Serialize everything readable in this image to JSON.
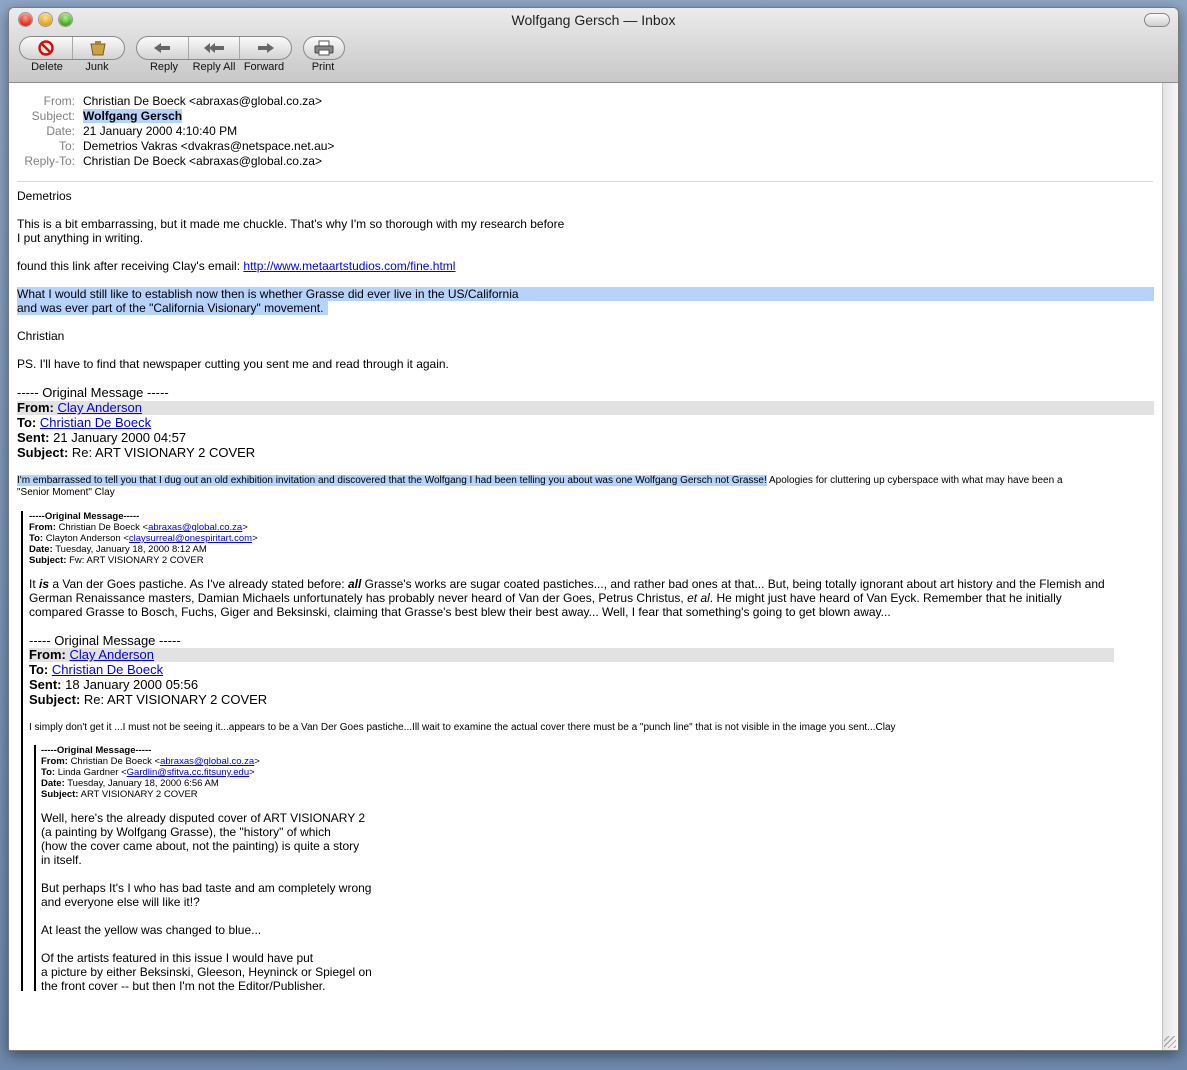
{
  "window": {
    "title": "Wolfgang Gersch — Inbox"
  },
  "toolbar": {
    "delete": "Delete",
    "junk": "Junk",
    "reply": "Reply",
    "reply_all": "Reply All",
    "forward": "Forward",
    "print": "Print"
  },
  "headers": {
    "from_label": "From:",
    "from": "Christian De Boeck <abraxas@global.co.za>",
    "subject_label": "Subject:",
    "subject": "Wolfgang Gersch",
    "date_label": "Date:",
    "date": "21 January 2000 4:10:40 PM",
    "to_label": "To:",
    "to": "Demetrios Vakras <dvakras@netspace.net.au>",
    "reply_to_label": "Reply-To:",
    "reply_to": "Christian De Boeck <abraxas@global.co.za>"
  },
  "body": {
    "greeting": "Demetrios",
    "p1_l1": "This is a bit embarrassing, but it made me chuckle. That's why I'm so thorough with my research before",
    "p1_l2": "I put anything in writing.",
    "p2_pre": "found this link after receiving Clay's email: ",
    "p2_link": "http://www.metaartstudios.com/fine.html",
    "p3_pre": "What ",
    "p3_hl1": "I would still like to establish now then is whether Grasse did ever live in the US/California",
    "p3_hl2": "and was ever part of the \"California Visionary\" movement.",
    "sign": "Christian",
    "ps": "PS. I'll have to find that newspaper cutting you sent me and read through it again."
  },
  "quote1": {
    "header": "----- Original Message -----",
    "from_label": "From:",
    "from": "Clay Anderson",
    "to_label": "To:",
    "to": "Christian De Boeck",
    "sent_label": "Sent:",
    "sent": "21 January 2000 04:57",
    "subject_label": "Subject:",
    "subject": "Re: ART VISIONARY 2 COVER",
    "msg_hl": "I'm embarrassed to tell you that I dug out an old exhibition invitation and discovered that the Wolfgang I had been telling you about was one Wolfgang Gersch not Grasse!",
    "msg_rest": " Apologies for cluttering up cyberspace with what may have been a",
    "msg_l2": "\"Senior Moment\"   Clay"
  },
  "quote2": {
    "header": "-----Original Message-----",
    "from_label": "From:",
    "from_pre": "Christian De Boeck <",
    "from_email": "abraxas@global.co.za",
    "from_post": ">",
    "to_label": "To:",
    "to_pre": "Clayton Anderson <",
    "to_email": "claysurreal@onespiritart.com",
    "to_post": ">",
    "date_label": "Date:",
    "date": "Tuesday, January 18, 2000 8:12 AM",
    "subject_label": "Subject:",
    "subject": "Fw: ART VISIONARY 2 COVER",
    "l1_a": "It ",
    "l1_is": "is",
    "l1_b": " a Van der Goes pastiche. As I've already stated before: ",
    "l1_all": "all",
    "l1_c": " Grasse's works are sugar coated pastiches..., and rather bad ones at that... But, being totally ignorant about art history and the Flemish and",
    "l2_a": "German Renaissance masters, Damian Michaels unfortunately has probably never heard of Van der Goes, Petrus Christus, ",
    "l2_etal": "et al",
    "l2_b": ". He might just have heard of Van Eyck. Remember that he initially",
    "l3": "compared Grasse to Bosch, Fuchs, Giger and Beksinski, claiming that Grasse's best blew their best away... Well, I fear that something's going to get blown away..."
  },
  "quote3": {
    "header": "----- Original Message -----",
    "from_label": "From:",
    "from": "Clay Anderson",
    "to_label": "To:",
    "to": "Christian De Boeck",
    "sent_label": "Sent:",
    "sent": "18 January 2000 05:56",
    "subject_label": "Subject:",
    "subject": "Re: ART VISIONARY 2 COVER",
    "msg": "I simply don't get it ...I must not be seeing it...appears to be a Van Der Goes pastiche...Ill wait to examine the actual cover there must be a \"punch line\" that is not visible in the image you sent...Clay"
  },
  "quote4": {
    "header": "-----Original Message-----",
    "from_label": "From:",
    "from_pre": "Christian De Boeck <",
    "from_email": "abraxas@global.co.za",
    "from_post": ">",
    "to_label": "To:",
    "to_pre": "Linda Gardner <",
    "to_email": "Gardlin@sfitva.cc.fitsuny.edu",
    "to_post": ">",
    "date_label": "Date:",
    "date": "Tuesday, January 18, 2000 6:56 AM",
    "subject_label": "Subject:",
    "subject": "ART VISIONARY 2 COVER",
    "b1": "Well, here's the already disputed cover of ART VISIONARY 2",
    "b2": "(a painting by Wolfgang Grasse), the \"history\" of which",
    "b3": "(how the cover came about, not the painting) is quite a story",
    "b4": "in itself.",
    "b5": "But perhaps It's I who has bad taste and am completely wrong",
    "b6": "and everyone else will like it!?",
    "b7": "At least the yellow was changed to blue...",
    "b8": "Of the artists featured in this issue I would have put",
    "b9": "a picture by either Beksinski, Gleeson, Heyninck or Spiegel on",
    "b10": "the front cover -- but then I'm not the Editor/Publisher."
  }
}
